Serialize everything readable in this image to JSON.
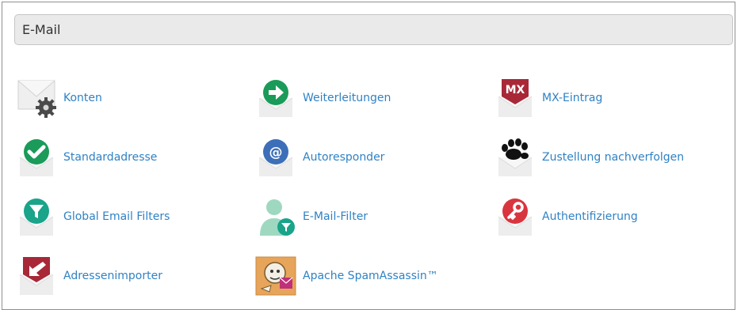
{
  "section": {
    "title": "E-Mail"
  },
  "items": [
    {
      "label": "Konten",
      "icon": "envelope-gear-icon"
    },
    {
      "label": "Weiterleitungen",
      "icon": "forward-arrow-envelope-icon"
    },
    {
      "label": "MX-Eintrag",
      "icon": "mx-envelope-icon"
    },
    {
      "label": "Standardadresse",
      "icon": "checkmark-envelope-icon"
    },
    {
      "label": "Autoresponder",
      "icon": "at-sign-envelope-icon"
    },
    {
      "label": "Zustellung nachverfolgen",
      "icon": "paw-print-envelope-icon"
    },
    {
      "label": "Global Email Filters",
      "icon": "funnel-envelope-icon"
    },
    {
      "label": "E-Mail-Filter",
      "icon": "user-filter-icon"
    },
    {
      "label": "Authentifizierung",
      "icon": "key-envelope-icon"
    },
    {
      "label": "Adressenimporter",
      "icon": "import-arrow-envelope-icon"
    },
    {
      "label": "Apache SpamAssassin™",
      "icon": "spamassassin-icon"
    }
  ],
  "colors": {
    "link": "#2f82c4",
    "header_bg": "#eaeaea",
    "green": "#1a9b59",
    "blue": "#3d6fb8",
    "crimson": "#a82838",
    "red": "#d9353f",
    "teal": "#1aa48a",
    "mint": "#9fd8c0",
    "black": "#111111"
  }
}
